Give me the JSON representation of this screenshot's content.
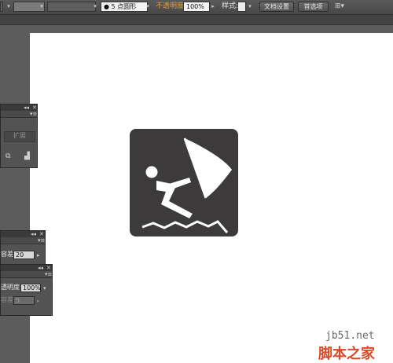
{
  "toolbar": {
    "point_shape": "● 5 点圆形",
    "opacity_label": "不透明度",
    "opacity_value": "100%",
    "style_label": "样式:",
    "doc_setup_button": "文档设置",
    "preferences_button": "首选项"
  },
  "panels": {
    "top": {
      "expand_button": "扩展"
    },
    "middle": {
      "tolerance_label": "容差:",
      "tolerance_value": "20"
    },
    "bottom": {
      "opacity_label": "透明度:",
      "opacity_value": "100%",
      "tolerance_label": "容差:",
      "tolerance_value": "5"
    }
  },
  "artwork": {
    "subject": "windsurfer-pictogram",
    "background": "#3c3a3a",
    "foreground": "#ffffff"
  },
  "watermark": {
    "domain": "jb51.net",
    "site_name": "脚本之家"
  }
}
